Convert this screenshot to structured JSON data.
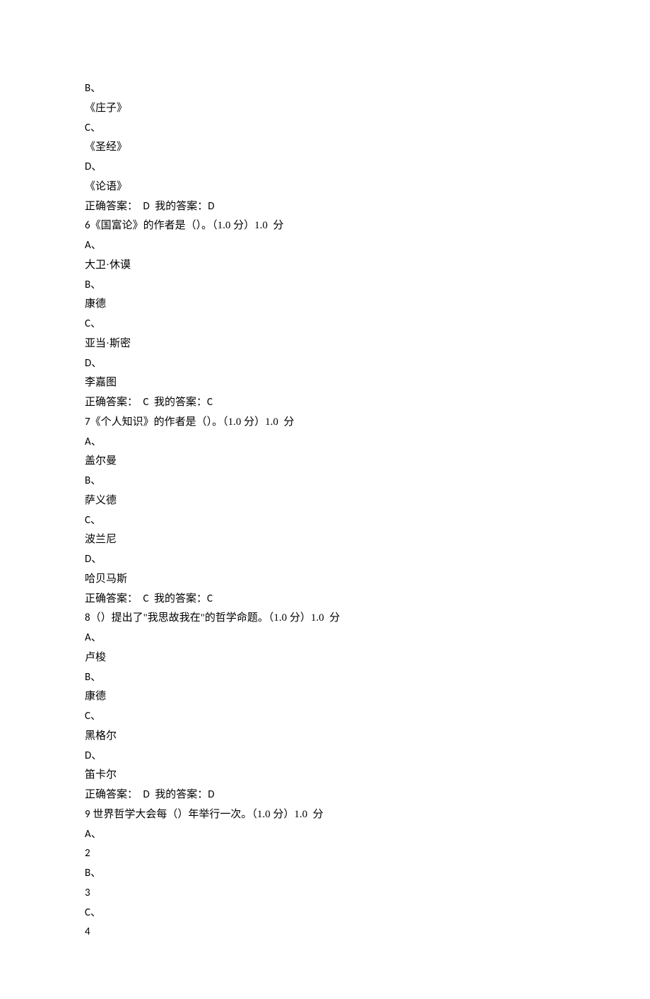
{
  "questions": [
    {
      "continuation": true,
      "options": [
        {
          "letter": "B",
          "text": "《庄子》"
        },
        {
          "letter": "C",
          "text": "《圣经》"
        },
        {
          "letter": "D",
          "text": "《论语》"
        }
      ],
      "answer": {
        "correct_label": "正确答案：",
        "correct": "D",
        "mine_label": "我的答案：",
        "mine": "D"
      }
    },
    {
      "number": "6",
      "prompt": "《国富论》的作者是（）。（1.0 分）1.0  分",
      "options": [
        {
          "letter": "A",
          "text": "大卫·休谟"
        },
        {
          "letter": "B",
          "text": "康德"
        },
        {
          "letter": "C",
          "text": "亚当·斯密"
        },
        {
          "letter": "D",
          "text": "李嘉图"
        }
      ],
      "answer": {
        "correct_label": "正确答案：",
        "correct": "C",
        "mine_label": "我的答案：",
        "mine": "C"
      }
    },
    {
      "number": "7",
      "prompt": "《个人知识》的作者是（）。（1.0 分）1.0  分",
      "options": [
        {
          "letter": "A",
          "text": "盖尔曼"
        },
        {
          "letter": "B",
          "text": "萨义德"
        },
        {
          "letter": "C",
          "text": "波兰尼"
        },
        {
          "letter": "D",
          "text": "哈贝马斯"
        }
      ],
      "answer": {
        "correct_label": "正确答案：",
        "correct": "C",
        "mine_label": "我的答案：",
        "mine": "C"
      }
    },
    {
      "number": "8",
      "prompt": "（）提出了\"我思故我在\"的哲学命题。（1.0 分）1.0  分",
      "options": [
        {
          "letter": "A",
          "text": "卢梭"
        },
        {
          "letter": "B",
          "text": "康德"
        },
        {
          "letter": "C",
          "text": "黑格尔"
        },
        {
          "letter": "D",
          "text": "笛卡尔"
        }
      ],
      "answer": {
        "correct_label": "正确答案：",
        "correct": "D",
        "mine_label": "我的答案：",
        "mine": "D"
      }
    },
    {
      "number": "9",
      "prompt": "世界哲学大会每（）年举行一次。（1.0 分）1.0  分",
      "options": [
        {
          "letter": "A",
          "text": "2"
        },
        {
          "letter": "B",
          "text": "3"
        },
        {
          "letter": "C",
          "text": "4"
        }
      ]
    }
  ]
}
